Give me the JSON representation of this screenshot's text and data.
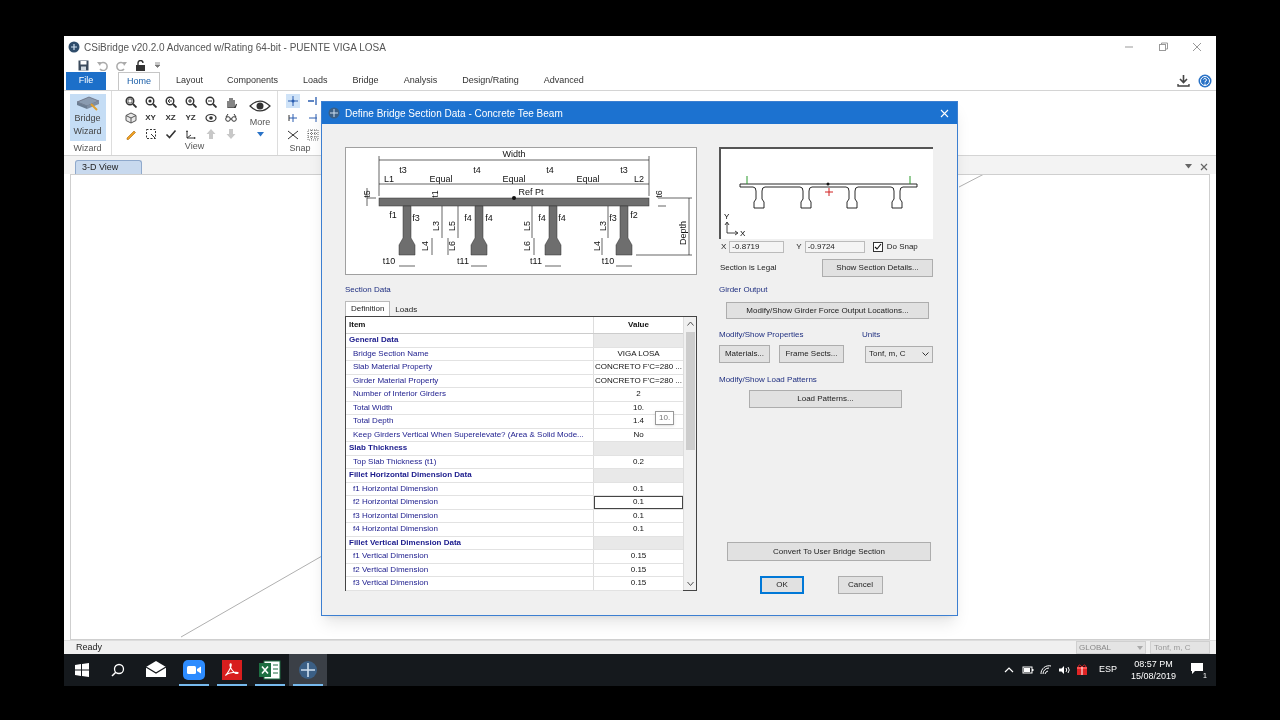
{
  "app": {
    "title": "CSiBridge v20.2.0 Advanced w/Rating 64-bit - PUENTE VIGA LOSA"
  },
  "ribbon": {
    "tabs": [
      {
        "label": "File",
        "kind": "file",
        "selected": false
      },
      {
        "label": "Home",
        "kind": "tab",
        "selected": true
      },
      {
        "label": "Layout",
        "kind": "tab",
        "selected": false
      },
      {
        "label": "Components",
        "kind": "tab",
        "selected": false
      },
      {
        "label": "Loads",
        "kind": "tab",
        "selected": false
      },
      {
        "label": "Bridge",
        "kind": "tab",
        "selected": false
      },
      {
        "label": "Analysis",
        "kind": "tab",
        "selected": false
      },
      {
        "label": "Design/Rating",
        "kind": "tab",
        "selected": false
      },
      {
        "label": "Advanced",
        "kind": "tab",
        "selected": false
      }
    ],
    "wizard_button": "Bridge Wizard",
    "groups": [
      "Wizard",
      "View",
      "Snap"
    ],
    "axis_buttons": [
      "XY",
      "XZ",
      "YZ"
    ],
    "more_button": "More"
  },
  "view_tabs": [
    {
      "label": "3-D View",
      "selected": true
    }
  ],
  "dialog": {
    "title": "Define Bridge Section Data - Concrete Tee Beam",
    "section_drawing": {
      "labels": [
        "Width",
        "L1",
        "t3",
        "Equal",
        "t4",
        "Equal",
        "t4",
        "Equal",
        "t3",
        "L2",
        "t5",
        "t1",
        "Ref Pt",
        "t6",
        "f1",
        "f3",
        "L3",
        "L5",
        "f4",
        "f4",
        "L5",
        "f4",
        "f4",
        "L3",
        "f3",
        "f2",
        "L4",
        "L6",
        "L6",
        "L4",
        "Depth",
        "t10",
        "t11",
        "t11",
        "t10"
      ]
    },
    "section_data": {
      "title": "Section Data",
      "tabs": [
        {
          "label": "Definition",
          "selected": true
        },
        {
          "label": "Loads",
          "selected": false
        }
      ],
      "table": {
        "columns": [
          "Item",
          "Value"
        ],
        "rows": [
          {
            "kind": "group",
            "label": "General Data"
          },
          {
            "kind": "item",
            "label": "Bridge Section Name",
            "value": "VIGA LOSA",
            "selected": false
          },
          {
            "kind": "item",
            "label": "Slab Material Property",
            "value": "CONCRETO F'C=280 ...",
            "selected": false
          },
          {
            "kind": "item",
            "label": "Girder Material Property",
            "value": "CONCRETO F'C=280 ...",
            "selected": false
          },
          {
            "kind": "item",
            "label": "Number of Interior Girders",
            "value": "2",
            "selected": false
          },
          {
            "kind": "item",
            "label": "Total Width",
            "value": "10.",
            "selected": false
          },
          {
            "kind": "item",
            "label": "Total Depth",
            "value": "1.4",
            "selected": false,
            "tooltip": "10."
          },
          {
            "kind": "item",
            "label": "Keep Girders Vertical When Superelevate?  (Area & Solid Mode...",
            "value": "No",
            "selected": false
          },
          {
            "kind": "group",
            "label": "Slab Thickness"
          },
          {
            "kind": "item",
            "label": "Top Slab Thickness (t1)",
            "value": "0.2",
            "selected": false
          },
          {
            "kind": "group",
            "label": "Fillet Horizontal Dimension Data"
          },
          {
            "kind": "item",
            "label": "f1 Horizontal Dimension",
            "value": "0.1",
            "selected": false
          },
          {
            "kind": "item",
            "label": "f2 Horizontal Dimension",
            "value": "0.1",
            "selected": true
          },
          {
            "kind": "item",
            "label": "f3 Horizontal Dimension",
            "value": "0.1",
            "selected": false
          },
          {
            "kind": "item",
            "label": "f4 Horizontal Dimension",
            "value": "0.1",
            "selected": false
          },
          {
            "kind": "group",
            "label": "Fillet Vertical Dimension Data"
          },
          {
            "kind": "item",
            "label": "f1 Vertical Dimension",
            "value": "0.15",
            "selected": false
          },
          {
            "kind": "item",
            "label": "f2 Vertical Dimension",
            "value": "0.15",
            "selected": false
          },
          {
            "kind": "item",
            "label": "f3 Vertical Dimension",
            "value": "0.15",
            "selected": false
          }
        ]
      }
    },
    "preview": {
      "axis_labels": [
        "Y",
        "X"
      ],
      "x_label": "X",
      "x_value": "-0.8719",
      "y_label": "Y",
      "y_value": "-0.9724",
      "do_snap": {
        "label": "Do Snap",
        "checked": true
      },
      "status": "Section is Legal",
      "details_button": "Show Section Details..."
    },
    "girder_output": {
      "title": "Girder Output",
      "button": "Modify/Show Girder Force Output Locations..."
    },
    "properties": {
      "title": "Modify/Show Properties",
      "buttons": [
        "Materials...",
        "Frame Sects..."
      ]
    },
    "units": {
      "title": "Units",
      "value": "Tonf, m, C"
    },
    "load_patterns": {
      "title": "Modify/Show Load Patterns",
      "button": "Load Patterns..."
    },
    "convert_button": "Convert To User Bridge Section",
    "buttons": [
      {
        "label": "OK",
        "focused": true
      },
      {
        "label": "Cancel",
        "focused": false
      }
    ]
  },
  "status_bar": {
    "text": "Ready",
    "coordinate_system": "GLOBAL",
    "units": "Tonf, m, C"
  },
  "taskbar": {
    "apps": [
      {
        "kind": "mail",
        "running": false,
        "selected": false
      },
      {
        "kind": "video",
        "running": true,
        "selected": false
      },
      {
        "kind": "pdf",
        "running": true,
        "selected": false
      },
      {
        "kind": "spreadsheet",
        "running": true,
        "selected": false
      },
      {
        "kind": "bridge",
        "running": true,
        "selected": true
      }
    ],
    "language": "ESP",
    "time": "08:57 PM",
    "date": "15/08/2019",
    "notifications": "1"
  }
}
